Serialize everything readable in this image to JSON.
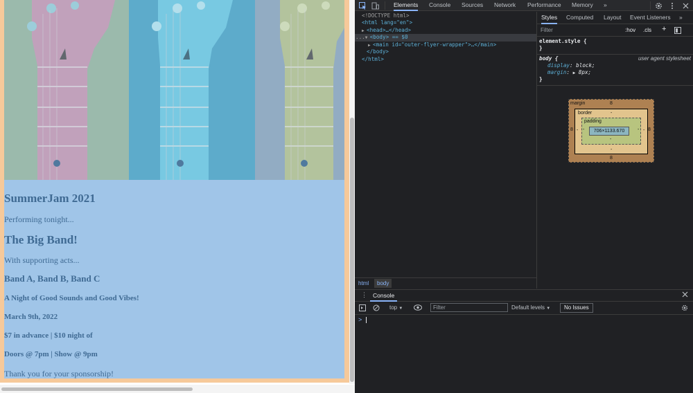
{
  "page": {
    "flyer": {
      "event_title": "SummerJam 2021",
      "performing": "Performing tonight...",
      "headliner": "The Big Band!",
      "supporting_intro": "With supporting acts...",
      "supporting_bands": "Band A, Band B, Band C",
      "tagline": "A Night of Good Sounds and Good Vibes!",
      "date": "March 9th, 2022",
      "price": "$7 in advance | $10 night of",
      "times": "Doors @ 7pm | Show @ 9pm",
      "thanks": "Thank you for your sponsorship!"
    },
    "colors": {
      "body_overlay": "#a0c5e8",
      "margin_overlay": "#f6c99a",
      "text": "#3f6a93"
    }
  },
  "devtools": {
    "tabs": [
      "Elements",
      "Console",
      "Sources",
      "Network",
      "Performance",
      "Memory"
    ],
    "active_tab": "Elements",
    "more_tabs": "»",
    "dom": {
      "doctype": "<!DOCTYPE html>",
      "html_open": "<html lang=\"en\">",
      "head": "<head>…</head>",
      "body_line": "<body> == $0",
      "main": "<main id=\"outer-flyer-wrapper\">…</main>",
      "body_close": "</body>",
      "html_close": "</html>",
      "ellipsis": "..."
    },
    "crumbs": [
      "html",
      "body"
    ],
    "styles_tabs": [
      "Styles",
      "Computed",
      "Layout",
      "Event Listeners"
    ],
    "styles_more": "»",
    "filter_placeholder": "Filter",
    "hov": ":hov",
    "cls": ".cls",
    "plus": "+",
    "rules": {
      "element_style": "element.style {",
      "close": "}",
      "body_selector": "body {",
      "source": "user agent stylesheet",
      "prop1": "display",
      "val1": "block;",
      "prop2": "margin",
      "val2": "8px;"
    },
    "box_model": {
      "margin_label": "margin",
      "border_label": "border",
      "padding_label": "padding",
      "margin": "8",
      "dash": "-",
      "content": "706×1133.670"
    },
    "console": {
      "title": "Console",
      "context": "top",
      "filter_placeholder": "Filter",
      "levels": "Default levels",
      "issues": "No Issues",
      "prompt": ">"
    }
  }
}
